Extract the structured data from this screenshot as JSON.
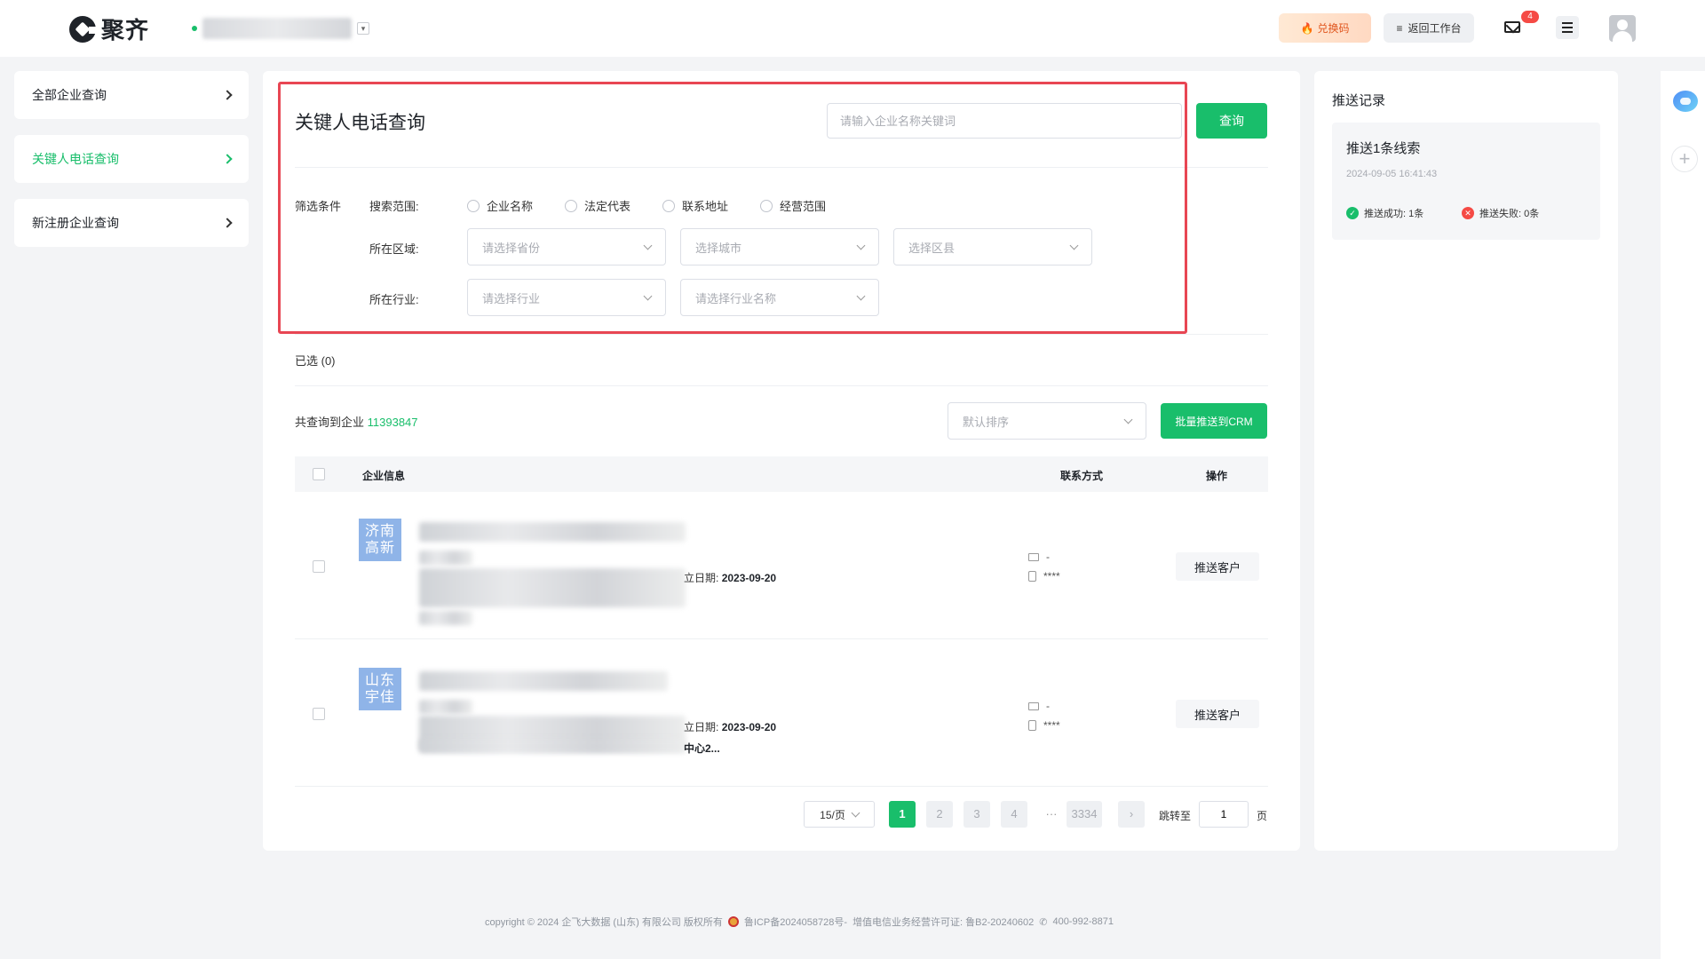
{
  "brand": {
    "name": "聚齐"
  },
  "org": {
    "prefix": "•"
  },
  "header": {
    "redeem_label": "兑换码",
    "back_label": "返回工作台",
    "mail_badge": "4"
  },
  "sidebar": {
    "items": [
      {
        "label": "全部企业查询",
        "active": false
      },
      {
        "label": "关键人电话查询",
        "active": true
      },
      {
        "label": "新注册企业查询",
        "active": false
      }
    ]
  },
  "main": {
    "title": "关键人电话查询",
    "search_placeholder": "请输入企业名称关键词",
    "query_label": "查询",
    "filter_label": "筛选条件",
    "scope_label": "搜索范围:",
    "scope_options": [
      "企业名称",
      "法定代表",
      "联系地址",
      "经营范围"
    ],
    "region_label": "所在区域:",
    "province_placeholder": "请选择省份",
    "city_placeholder": "选择城市",
    "district_placeholder": "选择区县",
    "industry_label": "所在行业:",
    "industry_placeholder": "请选择行业",
    "industry_name_placeholder": "请选择行业名称",
    "selected_text": "已选 (0)",
    "total_prefix": "共查询到企业",
    "total_count": "11393847",
    "sort_placeholder": "默认排序",
    "bulk_label": "批量推送到CRM",
    "columns": {
      "company": "企业信息",
      "contact": "联系方式",
      "action": "操作"
    },
    "rows": [
      {
        "tag": "济南高新",
        "date_label": "立日期:",
        "date_value": "2023-09-20",
        "email": "-",
        "phone": "****",
        "action": "推送客户",
        "addr": ""
      },
      {
        "tag": "山东宇佳",
        "date_label": "立日期:",
        "date_value": "2023-09-20",
        "email": "-",
        "phone": "****",
        "action": "推送客户",
        "addr": "中心2..."
      }
    ],
    "pagination": {
      "page_size": "15/页",
      "pages": [
        "1",
        "2",
        "3",
        "4"
      ],
      "ellipsis": "···",
      "last_page": "3334",
      "next": "›",
      "jump_label": "跳转至",
      "jump_value": "1",
      "page_suffix": "页"
    }
  },
  "push_panel": {
    "title": "推送记录",
    "card_title": "推送1条线索",
    "time": "2024-09-05 16:41:43",
    "success": "推送成功: 1条",
    "fail": "推送失败: 0条"
  },
  "footer": {
    "copyright": "copyright © 2024 企飞大数据 (山东) 有限公司 版权所有",
    "icp": "鲁ICP备2024058728号-",
    "license": "增值电信业务经营许可证: 鲁B2-20240602",
    "phone": "400-992-8871"
  },
  "colors": {
    "accent": "#19be6b",
    "highlight": "#e84653",
    "tag": "#8fb4e8"
  }
}
